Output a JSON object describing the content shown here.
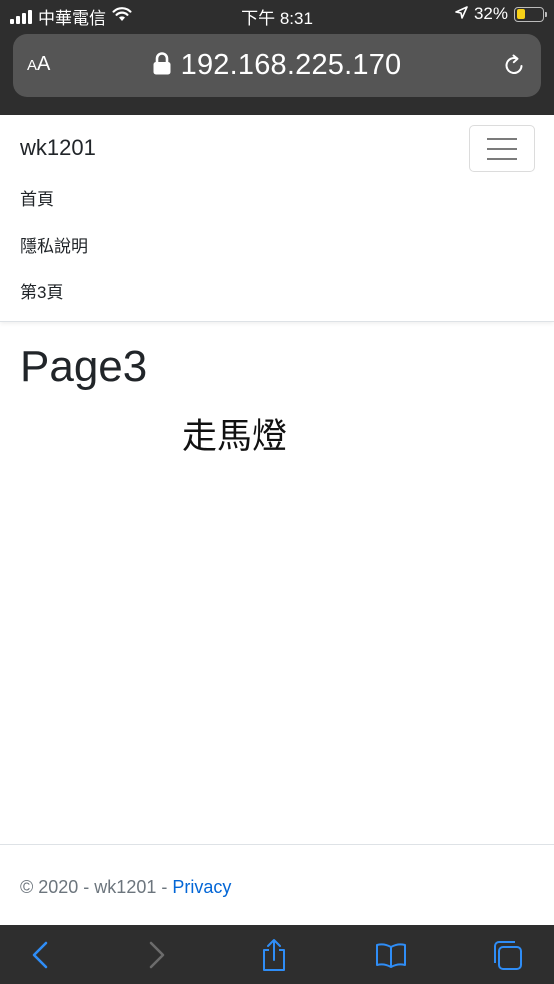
{
  "status_bar": {
    "carrier": "中華電信",
    "time": "下午 8:31",
    "battery": "32%",
    "battery_level": 0.32
  },
  "browser": {
    "text_size_label_small": "A",
    "text_size_label_large": "A",
    "url": "192.168.225.170"
  },
  "navbar": {
    "brand": "wk1201",
    "links": [
      "首頁",
      "隱私說明",
      "第3頁"
    ]
  },
  "main": {
    "title": "Page3",
    "marquee_text": "走馬燈"
  },
  "footer": {
    "copyright": "© 2020 - wk1201 - ",
    "privacy_link": "Privacy"
  },
  "colors": {
    "link": "#0366d6",
    "chrome_dark": "#2e2e2e",
    "toolbar_icon": "#2f8df6",
    "battery": "#f7d117"
  }
}
